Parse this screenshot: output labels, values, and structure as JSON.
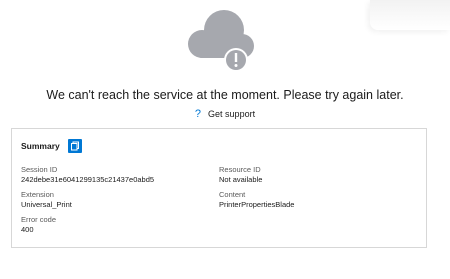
{
  "message": "We can't reach the service at the moment. Please try again later.",
  "support": {
    "icon": "question-icon",
    "label": "Get support"
  },
  "summary": {
    "title": "Summary",
    "copy_icon": "copy-icon",
    "fields": {
      "session_id": {
        "label": "Session ID",
        "value": "242debe31e6041299135c21437e0abd5"
      },
      "resource_id": {
        "label": "Resource ID",
        "value": "Not available"
      },
      "extension": {
        "label": "Extension",
        "value": "Universal_Print"
      },
      "content": {
        "label": "Content",
        "value": "PrinterPropertiesBlade"
      },
      "error_code": {
        "label": "Error code",
        "value": "400"
      }
    }
  },
  "colors": {
    "accent": "#0078d4",
    "cloud": "#a6a8ae",
    "border": "#d7d7d7"
  }
}
